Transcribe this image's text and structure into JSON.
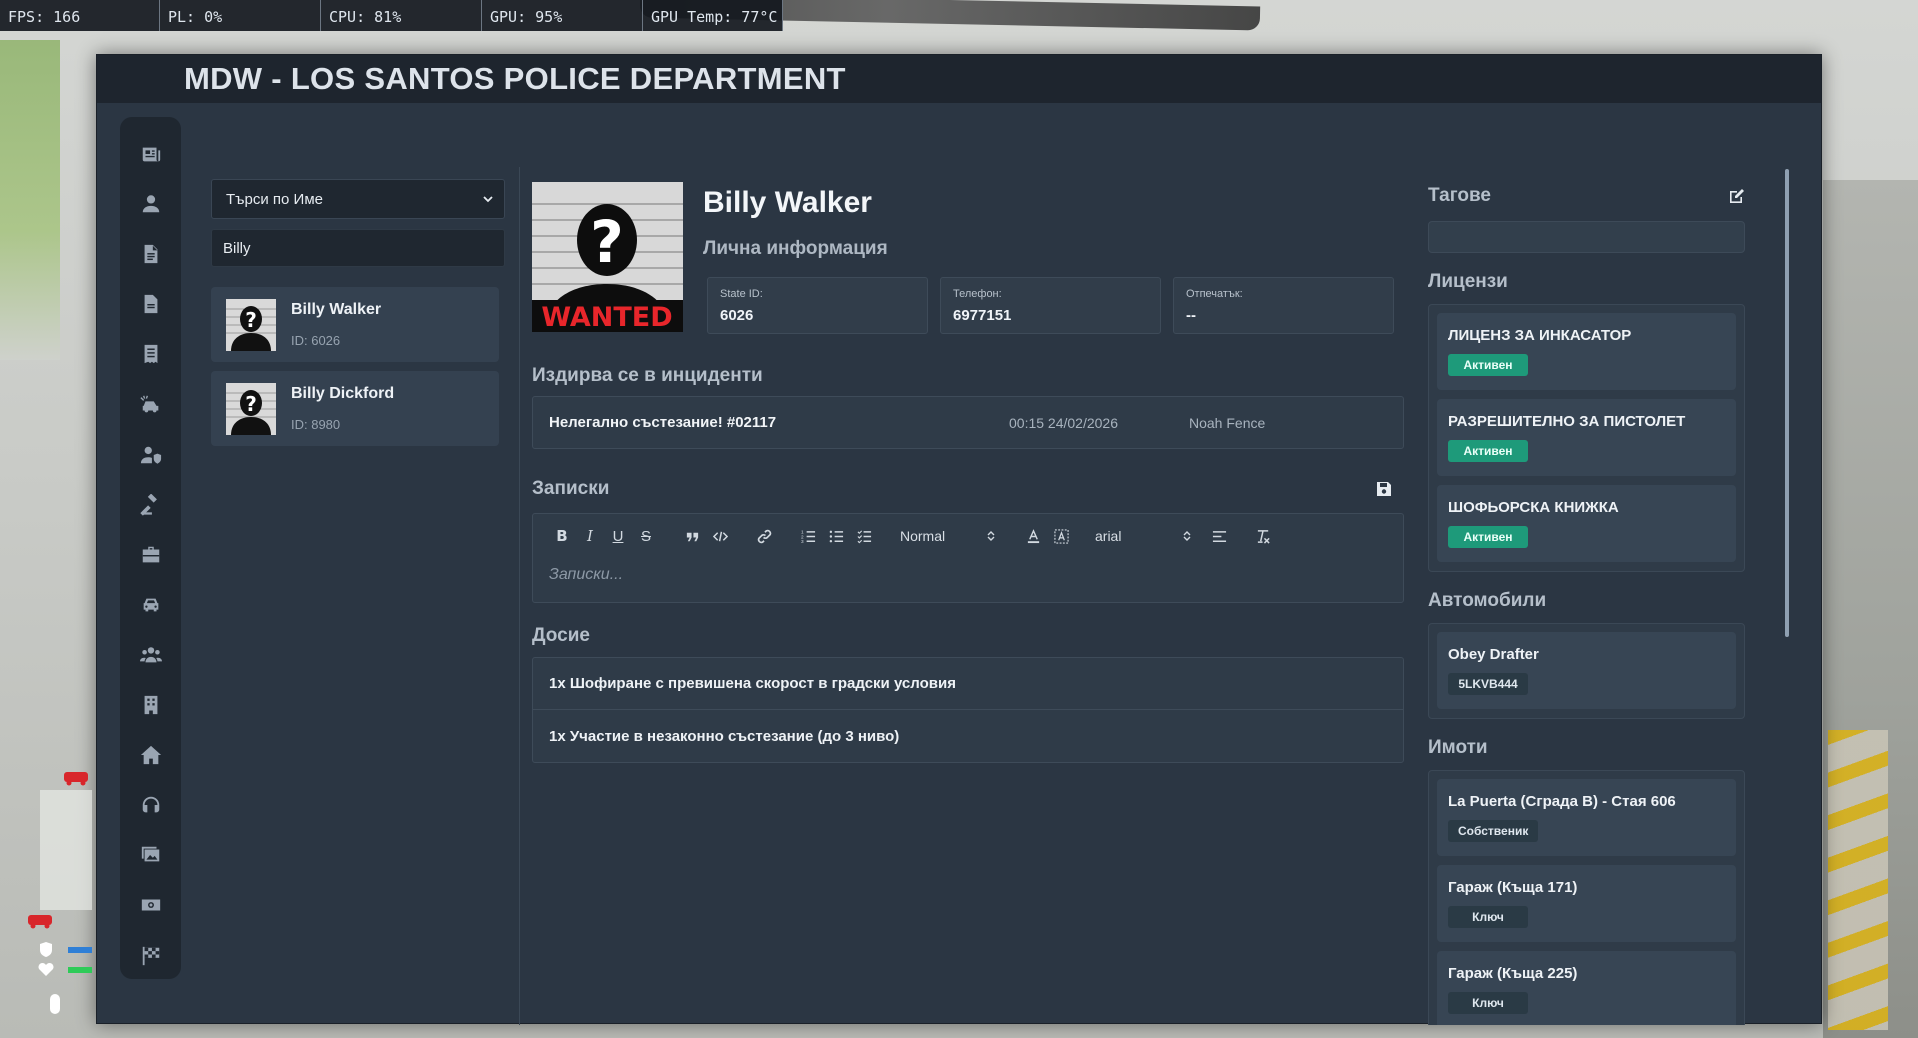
{
  "perf": [
    {
      "label": "FPS: 166"
    },
    {
      "label": "PL: 0%"
    },
    {
      "label": "CPU: 81%"
    },
    {
      "label": "GPU: 95%"
    },
    {
      "label": "GPU Temp: 77°C"
    }
  ],
  "window": {
    "title": "MDW - LOS SANTOS POLICE DEPARTMENT"
  },
  "rail_icons": [
    "newspaper-icon",
    "user-icon",
    "file-icon",
    "document-icon",
    "report-icon",
    "car-crash-icon",
    "user-shield-icon",
    "gavel-icon",
    "briefcase-icon",
    "car-icon",
    "users-icon",
    "building-icon",
    "home-icon",
    "headset-icon",
    "images-icon",
    "money-icon",
    "flag-icon"
  ],
  "search": {
    "mode": "Търси по Име",
    "query": "Billy",
    "results": [
      {
        "name": "Billy Walker",
        "id": "ID: 6026"
      },
      {
        "name": "Billy Dickford",
        "id": "ID: 8980"
      }
    ]
  },
  "profile": {
    "name": "Billy Walker",
    "section": "Лична информация",
    "wanted_text": "WANTED",
    "stats": [
      {
        "label": "State ID:",
        "value": "6026"
      },
      {
        "label": "Телефон:",
        "value": "6977151"
      },
      {
        "label": "Отпечатък:",
        "value": "--"
      }
    ]
  },
  "incidents": {
    "heading": "Издирва се в инциденти",
    "items": [
      {
        "title": "Нелегално състезание! #02117",
        "date": "00:15 24/02/2026",
        "officer": "Noah Fence"
      }
    ]
  },
  "notes": {
    "heading": "Записки",
    "placeholder": "Записки...",
    "size_value": "Normal",
    "font_value": "arial"
  },
  "dossier": {
    "heading": "Досие",
    "items": [
      "1x Шофиране с превишена скорост в градски условия",
      "1x Участие в незаконно състезание (до 3 ниво)"
    ]
  },
  "tags": {
    "heading": "Тагове"
  },
  "licenses": {
    "heading": "Лицензи",
    "items": [
      {
        "name": "ЛИЦЕНЗ ЗА ИНКАСАТОР",
        "status": "Активен"
      },
      {
        "name": "РАЗРЕШИТЕЛНО ЗА ПИСТОЛЕТ",
        "status": "Активен"
      },
      {
        "name": "ШОФЬОРСКА КНИЖКА",
        "status": "Активен"
      }
    ]
  },
  "vehicles": {
    "heading": "Автомобили",
    "items": [
      {
        "name": "Obey Drafter",
        "plate": "5LKVB444"
      }
    ]
  },
  "properties": {
    "heading": "Имоти",
    "items": [
      {
        "name": "La Puerta (Сграда B) - Стая 606",
        "role": "Собственик"
      },
      {
        "name": "Гараж (Къща 171)",
        "role": "Ключ"
      },
      {
        "name": "Гараж (Къща 225)",
        "role": "Ключ"
      }
    ]
  },
  "colors": {
    "window_bg": "#2b3643",
    "rail_bg": "#1f2730",
    "active_badge": "#1e9a7a",
    "wanted_red": "#e8262b"
  }
}
